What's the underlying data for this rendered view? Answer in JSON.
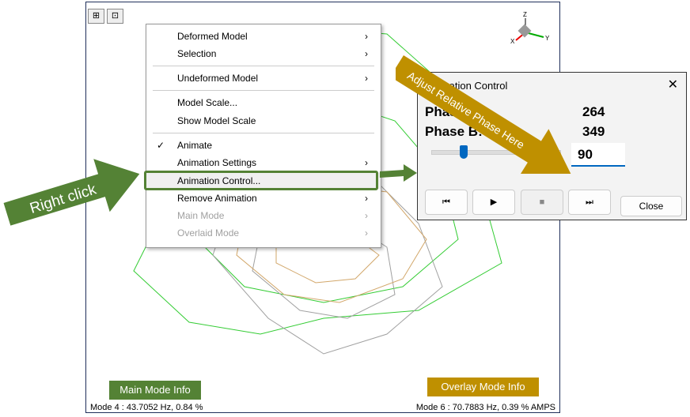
{
  "toolbar": {
    "icons": [
      "fit-view-icon",
      "zoom-icon"
    ]
  },
  "axis_triad": {
    "labels": [
      "Z",
      "X",
      "Y"
    ]
  },
  "context_menu": {
    "items": [
      {
        "label": "Deformed Model",
        "submenu": true,
        "enabled": true
      },
      {
        "label": "Selection",
        "submenu": true,
        "enabled": true
      },
      {
        "label": "Undeformed Model",
        "submenu": true,
        "enabled": true
      },
      {
        "label": "Model Scale...",
        "submenu": false,
        "enabled": true
      },
      {
        "label": "Show Model Scale",
        "submenu": false,
        "enabled": true
      },
      {
        "label": "Animate",
        "submenu": false,
        "enabled": true,
        "checked": true
      },
      {
        "label": "Animation Settings",
        "submenu": true,
        "enabled": true
      },
      {
        "label": "Animation Control...",
        "submenu": false,
        "enabled": true,
        "highlighted": true
      },
      {
        "label": "Remove Animation",
        "submenu": true,
        "enabled": true
      },
      {
        "label": "Main Mode",
        "submenu": true,
        "enabled": false
      },
      {
        "label": "Overlaid Mode",
        "submenu": true,
        "enabled": false
      }
    ],
    "check": "✓",
    "arrow": "›"
  },
  "dialog": {
    "title": "Animation Control",
    "close": "✕",
    "phase_label": "Phase:",
    "phase_value": "264",
    "phaseb_label": "Phase B:",
    "phaseb_value": "349",
    "relative_phase_input": "90",
    "slider_fraction": 0.2,
    "buttons": {
      "first": "⏮",
      "play": "▶",
      "stop": "■",
      "last": "⏭",
      "close": "Close"
    }
  },
  "annotations": {
    "right_click": "Right click",
    "adjust": "Adjust Relative Phase Here",
    "main_mode_info": "Main Mode Info",
    "overlay_mode_info": "Overlay Mode Info"
  },
  "status": {
    "main_mode": "Mode  4 : 43.7052 Hz, 0.84 %",
    "overlay_mode": "Mode  6 : 70.7883 Hz, 0.39 % AMPS"
  },
  "colors": {
    "green": "#548235",
    "gold": "#bf9000",
    "main_mesh": "#33cc33",
    "overlay_mesh": "#d2a76a",
    "undeformed": "#a0a0a0"
  }
}
